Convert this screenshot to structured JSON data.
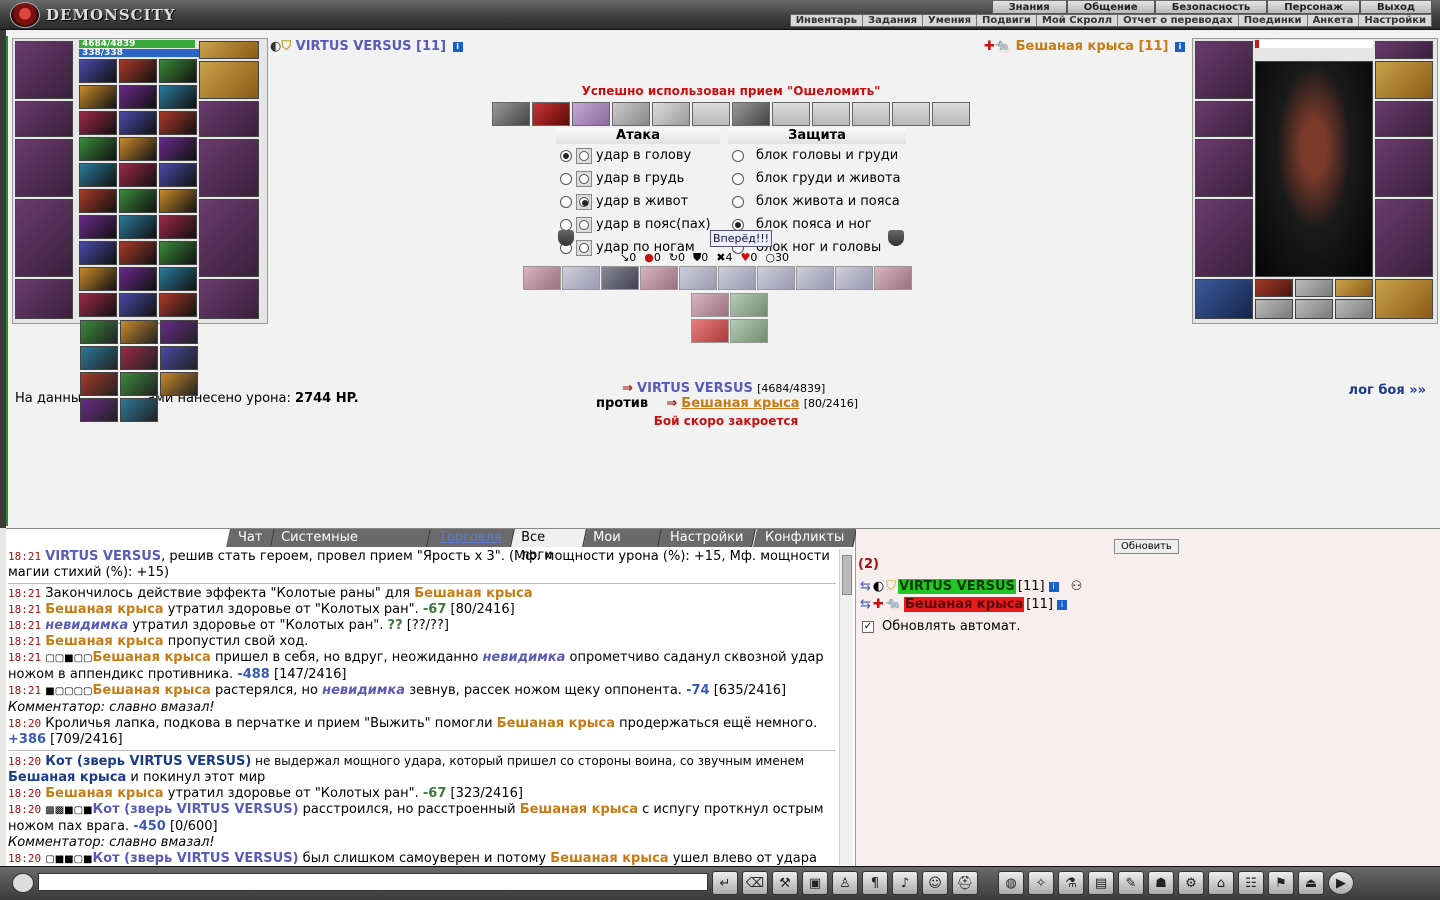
{
  "app": {
    "logo_text": "DEMONSCITY"
  },
  "menu_top": [
    "Знания",
    "Общение",
    "Безопасность",
    "Персонаж",
    "Выход"
  ],
  "menu_sub": [
    "Инвентарь",
    "Задания",
    "Умения",
    "Подвиги",
    "Мой Скролл",
    "Отчет о переводах",
    "Поединки",
    "Анкета",
    "Настройки"
  ],
  "player": {
    "name": "VIRTUS VERSUS",
    "level": "[11]",
    "hp_text": "4684/4839",
    "mana_text": "338/338",
    "hp_fraction": 0.968,
    "mana_fraction": 1.0
  },
  "enemy": {
    "name": "Бешаная крыса",
    "level": "[11]",
    "hp_text": "80/2416",
    "hp_fraction": 0.033
  },
  "battle": {
    "status_msg": "Успешно использован прием \"Ошеломить\"",
    "attack_title": "Атака",
    "defense_title": "Защита",
    "attacks": [
      "удар в голову",
      "удар в грудь",
      "удар в живот",
      "удар в пояс(пах)",
      "удар по ногам"
    ],
    "attack_selected": 2,
    "defenses": [
      "блок головы и груди",
      "блок груди и живота",
      "блок живота и пояса",
      "блок пояса и ног",
      "блок ног и головы"
    ],
    "defense_selected": 3,
    "go_button": "Вперёд!!!",
    "stats": [
      "0",
      "0",
      "0",
      "0",
      "4",
      "0",
      "30"
    ],
    "player_line_name": "VIRTUS VERSUS",
    "player_line_hp": "[4684/4839]",
    "vs_word": "против",
    "enemy_line_name": "Бешаная крыса",
    "enemy_line_hp": "[80/2416]",
    "damage_prefix": "На данны",
    "damage_middle": "ами нанесено урона:",
    "damage_value": "2744 HP.",
    "close_msg": "Бой скоро закроется",
    "log_link": "лог боя »»"
  },
  "chat_tabs": [
    {
      "label": "Чат",
      "state": "normal"
    },
    {
      "label": "Системные сообщения",
      "state": "normal"
    },
    {
      "label": "Торговля",
      "state": "link"
    },
    {
      "label": "Все логи",
      "state": "active"
    },
    {
      "label": "Мои логи",
      "state": "normal"
    },
    {
      "label": "Настройки",
      "state": "normal"
    },
    {
      "label": "Конфликты",
      "state": "normal"
    }
  ],
  "right_panel": {
    "refresh_button": "Обновить",
    "count": "(2)",
    "player_name": "VIRTUS VERSUS",
    "player_level": "[11]",
    "enemy_name": "Бешаная крыса",
    "enemy_level": "[11]",
    "auto_refresh_label": "Обновлять автомат."
  },
  "log": {
    "l1_time": "18:21",
    "l1_name": "VIRTUS VERSUS",
    "l1_text": ", решив стать героем, провел прием \"Ярость x 3\". (Мф. мощности урона (%): +15, Мф. мощности магии стихий (%): +15)",
    "l2_time": "18:21",
    "l2_text": "Закончилось действие эффекта \"Колотые раны\" для ",
    "l2_name": "Бешаная крыса",
    "l3_time": "18:21",
    "l3_name": "Бешаная крыса",
    "l3_text": " утратил здоровье от \"Колотых ран\". ",
    "l3_num": "-67",
    "l3_hp": " [80/2416]",
    "l4_time": "18:21",
    "l4_name": "невидимка",
    "l4_text": " утратил здоровье от \"Колотых ран\". ",
    "l4_num": "??",
    "l4_hp": " [??/??]",
    "l5_time": "18:21",
    "l5_name": "Бешаная крыса",
    "l5_text": " пропустил свой ход.",
    "l6_time": "18:21",
    "l6_name": "Бешаная крыса",
    "l6_text": " пришел в себя, но вдруг, неожиданно ",
    "l6_name2": "невидимка",
    "l6_text2": " опрометчиво саданул сквозной удар ножом в аппендикс противника. ",
    "l6_num": "-488",
    "l6_hp": " [147/2416]",
    "l7_time": "18:21",
    "l7_name": "Бешаная крыса",
    "l7_text": " растерялся, но ",
    "l7_name2": "невидимка",
    "l7_text2": " зевнув, рассек ножом щеку оппонента. ",
    "l7_num": "-74",
    "l7_hp": " [635/2416]",
    "l8_com": "Комментатор: славно вмазал!",
    "l9_time": "18:20",
    "l9_text": "Кроличья лапка, подкова в перчатке и прием \"Выжить\" помогли ",
    "l9_name": "Бешаная крыса",
    "l9_text2": " продержаться ещё немного. ",
    "l9_num": "+386",
    "l9_hp": " [709/2416]",
    "l10_time": "18:20",
    "l10_name": "Кот (зверь VIRTUS VERSUS)",
    "l10_text": " не выдержал мощного удара, который пришел со стороны воина, со звучным именем ",
    "l10_name2": "Бешаная крыса",
    "l10_text2": " и покинул этот мир",
    "l11_time": "18:20",
    "l11_name": "Бешаная крыса",
    "l11_text": " утратил здоровье от \"Колотых ран\". ",
    "l11_num": "-67",
    "l11_hp": " [323/2416]",
    "l12_time": "18:20",
    "l12_name": "Кот (зверь VIRTUS VERSUS)",
    "l12_text": " расстроился, но расстроенный ",
    "l12_name2": "Бешаная крыса",
    "l12_text2": " с испугу проткнул острым ножом пах врага. ",
    "l12_num": "-450",
    "l12_hp": " [0/600]",
    "l13_com": "Комментатор: славно вмазал!",
    "l14_time": "18:20",
    "l14_name": "Кот (зверь VIRTUS VERSUS)",
    "l14_text": " был слишком самоуверен и потому ",
    "l14_name2": "Бешаная крыса",
    "l14_text2": " ушел влево от удара когтистыми лапами по крестцу и влимил контрудар."
  }
}
